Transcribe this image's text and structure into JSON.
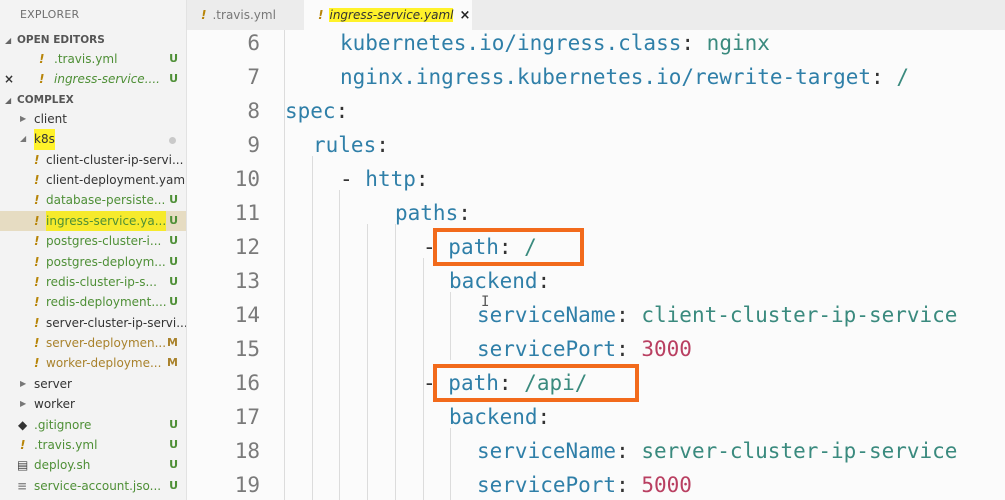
{
  "sidebar": {
    "title": "EXPLORER",
    "open_editors": {
      "label": "OPEN EDITORS",
      "items": [
        {
          "name": ".travis.yml",
          "badge": "U"
        },
        {
          "name": "ingress-service....",
          "badge": "U"
        }
      ]
    },
    "project": {
      "label": "COMPLEX",
      "items": [
        {
          "name": "client",
          "type": "folder"
        },
        {
          "name": "k8s",
          "type": "folder-open"
        },
        {
          "name": "client-cluster-ip-servi...",
          "badge": ""
        },
        {
          "name": "client-deployment.yaml",
          "badge": ""
        },
        {
          "name": "database-persiste...",
          "badge": "U"
        },
        {
          "name": "ingress-service.ya...",
          "badge": "U"
        },
        {
          "name": "postgres-cluster-i...",
          "badge": "U"
        },
        {
          "name": "postgres-deploym...",
          "badge": "U"
        },
        {
          "name": "redis-cluster-ip-s...",
          "badge": "U"
        },
        {
          "name": "redis-deployment....",
          "badge": "U"
        },
        {
          "name": "server-cluster-ip-servi...",
          "badge": ""
        },
        {
          "name": "server-deploymen...",
          "badge": "M"
        },
        {
          "name": "worker-deployme...",
          "badge": "M"
        },
        {
          "name": "server",
          "type": "folder"
        },
        {
          "name": "worker",
          "type": "folder"
        },
        {
          "name": ".gitignore",
          "badge": "U"
        },
        {
          "name": ".travis.yml",
          "badge": "U"
        },
        {
          "name": "deploy.sh",
          "badge": "U"
        },
        {
          "name": "service-account.jso...",
          "badge": "U"
        }
      ]
    }
  },
  "tabs": [
    {
      "label": ".travis.yml",
      "active": false
    },
    {
      "label": "ingress-service.yaml",
      "active": true,
      "close": "×"
    }
  ],
  "editor": {
    "lines": [
      {
        "n": "6",
        "key": "kubernetes.io/ingress.class",
        "sep": ": ",
        "val": "nginx"
      },
      {
        "n": "7",
        "key": "nginx.ingress.kubernetes.io/rewrite-target",
        "sep": ": ",
        "val": "/"
      },
      {
        "n": "8",
        "key": "spec",
        "sep": ":",
        "val": ""
      },
      {
        "n": "9",
        "key": "rules",
        "sep": ":",
        "val": ""
      },
      {
        "n": "10",
        "dash": "- ",
        "key": "http",
        "sep": ":",
        "val": ""
      },
      {
        "n": "11",
        "key": "paths",
        "sep": ":",
        "val": ""
      },
      {
        "n": "12",
        "dash": "- ",
        "key": "path",
        "sep": ": ",
        "val": "/"
      },
      {
        "n": "13",
        "key": "backend",
        "sep": ":",
        "val": ""
      },
      {
        "n": "14",
        "key": "serviceName",
        "sep": ": ",
        "val": "client-cluster-ip-service"
      },
      {
        "n": "15",
        "key": "servicePort",
        "sep": ": ",
        "val": "3000"
      },
      {
        "n": "16",
        "dash": "- ",
        "key": "path",
        "sep": ": ",
        "val": "/api/"
      },
      {
        "n": "17",
        "key": "backend",
        "sep": ":",
        "val": ""
      },
      {
        "n": "18",
        "key": "serviceName",
        "sep": ": ",
        "val": "server-cluster-ip-service"
      },
      {
        "n": "19",
        "key": "servicePort",
        "sep": ": ",
        "val": "5000"
      }
    ]
  },
  "colors": {
    "key": "#2f7fa8",
    "string": "#3a8a7e",
    "number": "#b93f61",
    "highlight_box": "#f26a1b",
    "marker_yellow": "#fff22a",
    "untracked_badge": "#4e8f36",
    "modified_badge": "#a9822c"
  }
}
